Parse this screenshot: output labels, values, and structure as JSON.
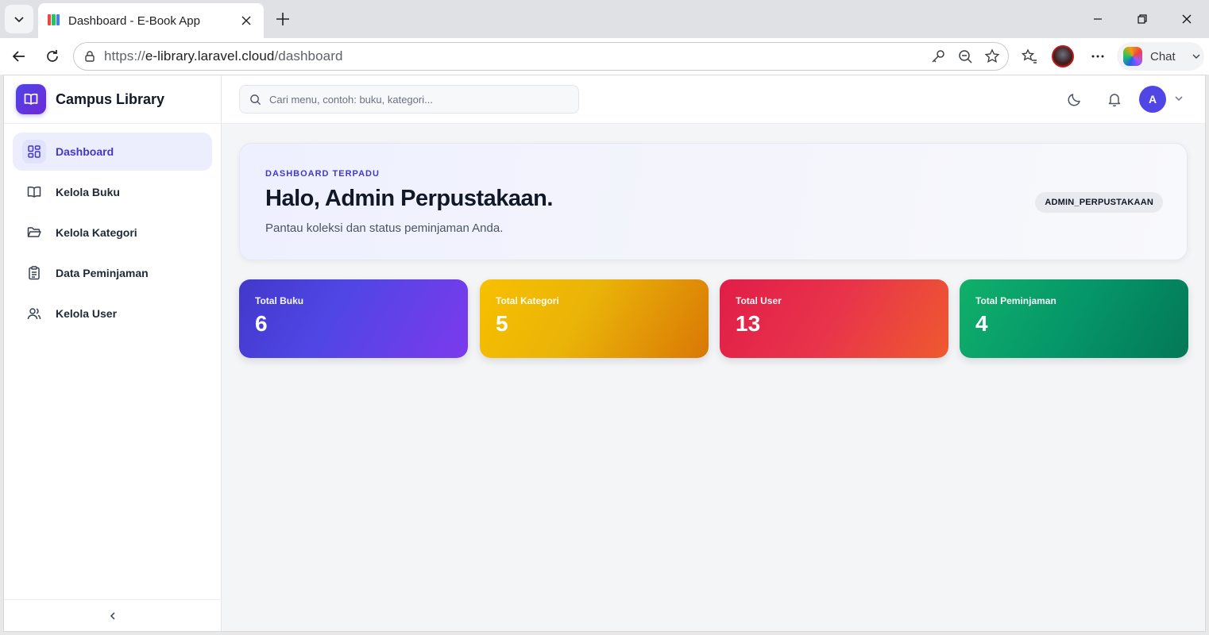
{
  "browser": {
    "tab_title": "Dashboard - E-Book App",
    "url_prefix": "https://",
    "url_host": "e-library.laravel.cloud",
    "url_path": "/dashboard",
    "chat_label": "Chat"
  },
  "sidebar": {
    "brand": "Campus Library",
    "items": [
      {
        "label": "Dashboard",
        "icon": "grid-icon",
        "active": true
      },
      {
        "label": "Kelola Buku",
        "icon": "book-open-icon",
        "active": false
      },
      {
        "label": "Kelola Kategori",
        "icon": "folder-open-icon",
        "active": false
      },
      {
        "label": "Data Peminjaman",
        "icon": "clipboard-icon",
        "active": false
      },
      {
        "label": "Kelola User",
        "icon": "users-icon",
        "active": false
      }
    ]
  },
  "topbar": {
    "search_placeholder": "Cari menu, contoh: buku, kategori...",
    "avatar_initial": "A"
  },
  "hero": {
    "eyebrow": "DASHBOARD TERPADU",
    "title": "Halo, Admin Perpustakaan.",
    "subtitle": "Pantau koleksi dan status peminjaman Anda.",
    "role_badge": "ADMIN_PERPUSTAKAAN"
  },
  "stats": [
    {
      "label": "Total Buku",
      "value": "6",
      "color": "#4f46e5"
    },
    {
      "label": "Total Kategori",
      "value": "5",
      "color": "#eab308"
    },
    {
      "label": "Total User",
      "value": "13",
      "color": "#e11d48"
    },
    {
      "label": "Total Peminjaman",
      "value": "4",
      "color": "#059669"
    }
  ],
  "colors": {
    "accent": "#4f46e5",
    "background": "#f4f5f7"
  }
}
